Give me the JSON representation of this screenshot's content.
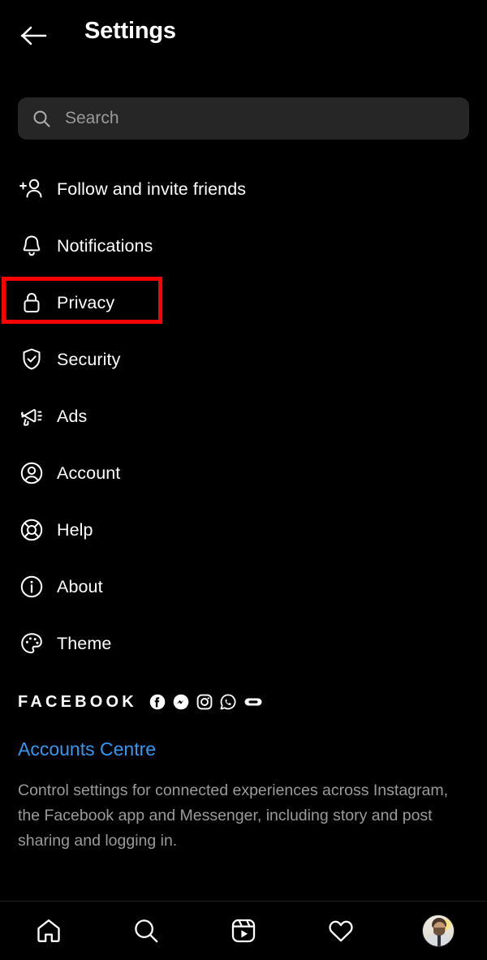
{
  "header": {
    "title": "Settings",
    "back_icon": "arrow-left-icon"
  },
  "search": {
    "placeholder": "Search",
    "value": "",
    "icon": "search-icon"
  },
  "menu": {
    "items": [
      {
        "label": "Follow and invite friends",
        "icon": "person-add-icon",
        "highlighted": false
      },
      {
        "label": "Notifications",
        "icon": "bell-icon",
        "highlighted": false
      },
      {
        "label": "Privacy",
        "icon": "lock-icon",
        "highlighted": true
      },
      {
        "label": "Security",
        "icon": "shield-check-icon",
        "highlighted": false
      },
      {
        "label": "Ads",
        "icon": "megaphone-icon",
        "highlighted": false
      },
      {
        "label": "Account",
        "icon": "account-circle-icon",
        "highlighted": false
      },
      {
        "label": "Help",
        "icon": "life-ring-icon",
        "highlighted": false
      },
      {
        "label": "About",
        "icon": "info-circle-icon",
        "highlighted": false
      },
      {
        "label": "Theme",
        "icon": "palette-icon",
        "highlighted": false
      }
    ]
  },
  "facebook_section": {
    "heading": "FACEBOOK",
    "brand_icons": [
      "facebook-icon",
      "messenger-icon",
      "instagram-icon",
      "whatsapp-icon",
      "portal-icon"
    ],
    "link_label": "Accounts Centre",
    "description": "Control settings for connected experiences across Instagram, the Facebook app and Messenger, including story and post sharing and logging in."
  },
  "bottom_nav": {
    "items": [
      {
        "name": "home",
        "icon": "home-icon"
      },
      {
        "name": "search",
        "icon": "search-icon"
      },
      {
        "name": "reels",
        "icon": "reels-icon"
      },
      {
        "name": "activity",
        "icon": "heart-icon"
      },
      {
        "name": "profile",
        "icon": "profile-avatar"
      }
    ]
  },
  "colors": {
    "background": "#000000",
    "search_field": "#262626",
    "text_primary": "#ffffff",
    "text_secondary": "#9a9a9a",
    "link_blue": "#3797f0",
    "highlight_red": "#ff0000"
  }
}
